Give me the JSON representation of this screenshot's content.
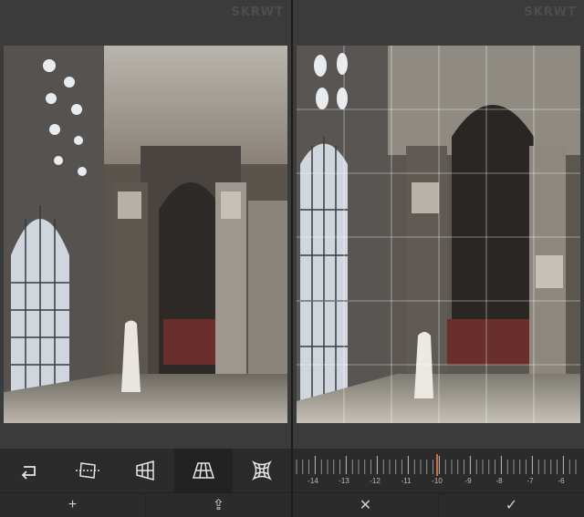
{
  "brand": "SKRWT",
  "left_panel": {
    "tools": [
      {
        "name": "undo-icon"
      },
      {
        "name": "lens-distortion-icon"
      },
      {
        "name": "vertical-perspective-icon"
      },
      {
        "name": "horizontal-perspective-icon",
        "active": true
      },
      {
        "name": "pincushion-icon"
      }
    ],
    "add_label": "+",
    "share_label": "⇪"
  },
  "right_panel": {
    "ruler": {
      "labels": [
        "-14",
        "-13",
        "-12",
        "-11",
        "-10",
        "-9",
        "-8",
        "-7",
        "-6"
      ],
      "current_value": -10,
      "indicator_color": "#d06a3a"
    },
    "cancel_label": "✕",
    "confirm_label": "✓"
  },
  "colors": {
    "accent": "#d06a3a",
    "toolbar_bg": "#2b2b2b",
    "panel_bg": "#3b3b3b"
  }
}
